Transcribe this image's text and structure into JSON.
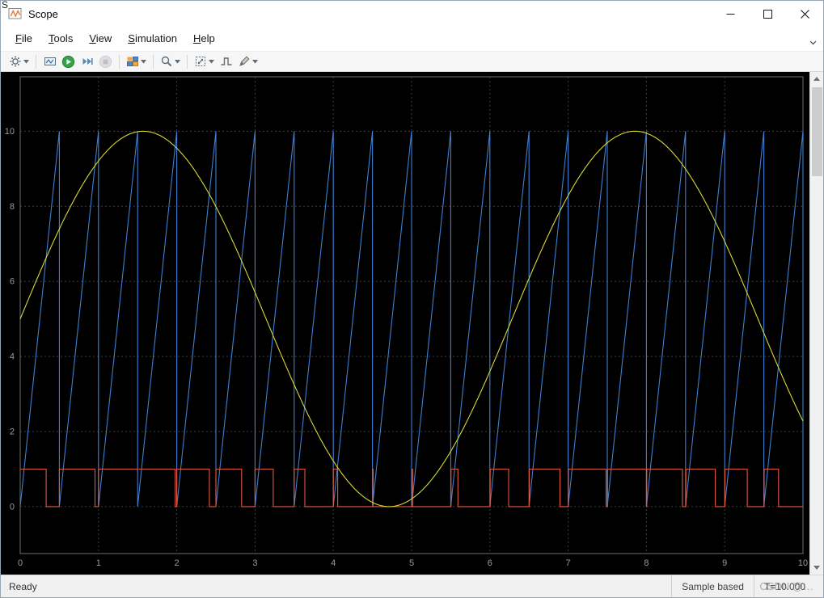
{
  "stray_text": "S",
  "window": {
    "title": "Scope"
  },
  "menu": {
    "items": [
      "File",
      "Tools",
      "View",
      "Simulation",
      "Help"
    ]
  },
  "toolbar": {
    "buttons": [
      {
        "name": "configuration",
        "icon": "gear-icon",
        "dropdown": true
      },
      {
        "name": "highlight-simulink-block",
        "icon": "scope-block-icon"
      },
      {
        "name": "run",
        "icon": "run-icon"
      },
      {
        "name": "step-forward",
        "icon": "step-forward-icon"
      },
      {
        "name": "stop",
        "icon": "stop-icon",
        "enabled": false
      },
      {
        "name": "layout",
        "icon": "layout-icon",
        "dropdown": true
      },
      {
        "name": "zoom",
        "icon": "zoom-icon",
        "dropdown": true
      },
      {
        "name": "span",
        "icon": "span-icon",
        "dropdown": true
      },
      {
        "name": "trigger",
        "icon": "trigger-icon"
      },
      {
        "name": "measurements",
        "icon": "measurements-icon",
        "dropdown": true
      }
    ]
  },
  "statusbar": {
    "left": "Ready",
    "sample_mode": "Sample based",
    "time": "T=10.000"
  },
  "watermark": "CSDN @…",
  "chart_data": {
    "type": "line",
    "title": "",
    "xlabel": "",
    "ylabel": "",
    "xlim": [
      0,
      10
    ],
    "ylim": [
      -1.25,
      11.45
    ],
    "x_ticks": [
      0,
      1,
      2,
      3,
      4,
      5,
      6,
      7,
      8,
      9,
      10
    ],
    "y_ticks": [
      0,
      2,
      4,
      6,
      8,
      10
    ],
    "grid": true,
    "legend": false,
    "background": "#000000",
    "grid_color": "#3e3e3e",
    "axis_color": "#6f6f6f",
    "tick_label_color": "#9c9c9c",
    "series": [
      {
        "name": "sine",
        "kind": "function",
        "description": "y = 5 + 5*sin(t), t in [0,10]",
        "offset": 5,
        "amplitude": 5,
        "angular_frequency": 1,
        "color": "#d8d839"
      },
      {
        "name": "sawtooth",
        "kind": "sawtooth",
        "description": "ramp 0 to 10, period 0.5 s",
        "period": 0.5,
        "min": 0,
        "max": 10,
        "color": "#3e7fd2"
      },
      {
        "name": "pwm-pulse",
        "kind": "comparator",
        "description": "1 when sine > sawtooth, else 0",
        "low": 0,
        "high": 1,
        "color": "#e05840"
      }
    ]
  }
}
